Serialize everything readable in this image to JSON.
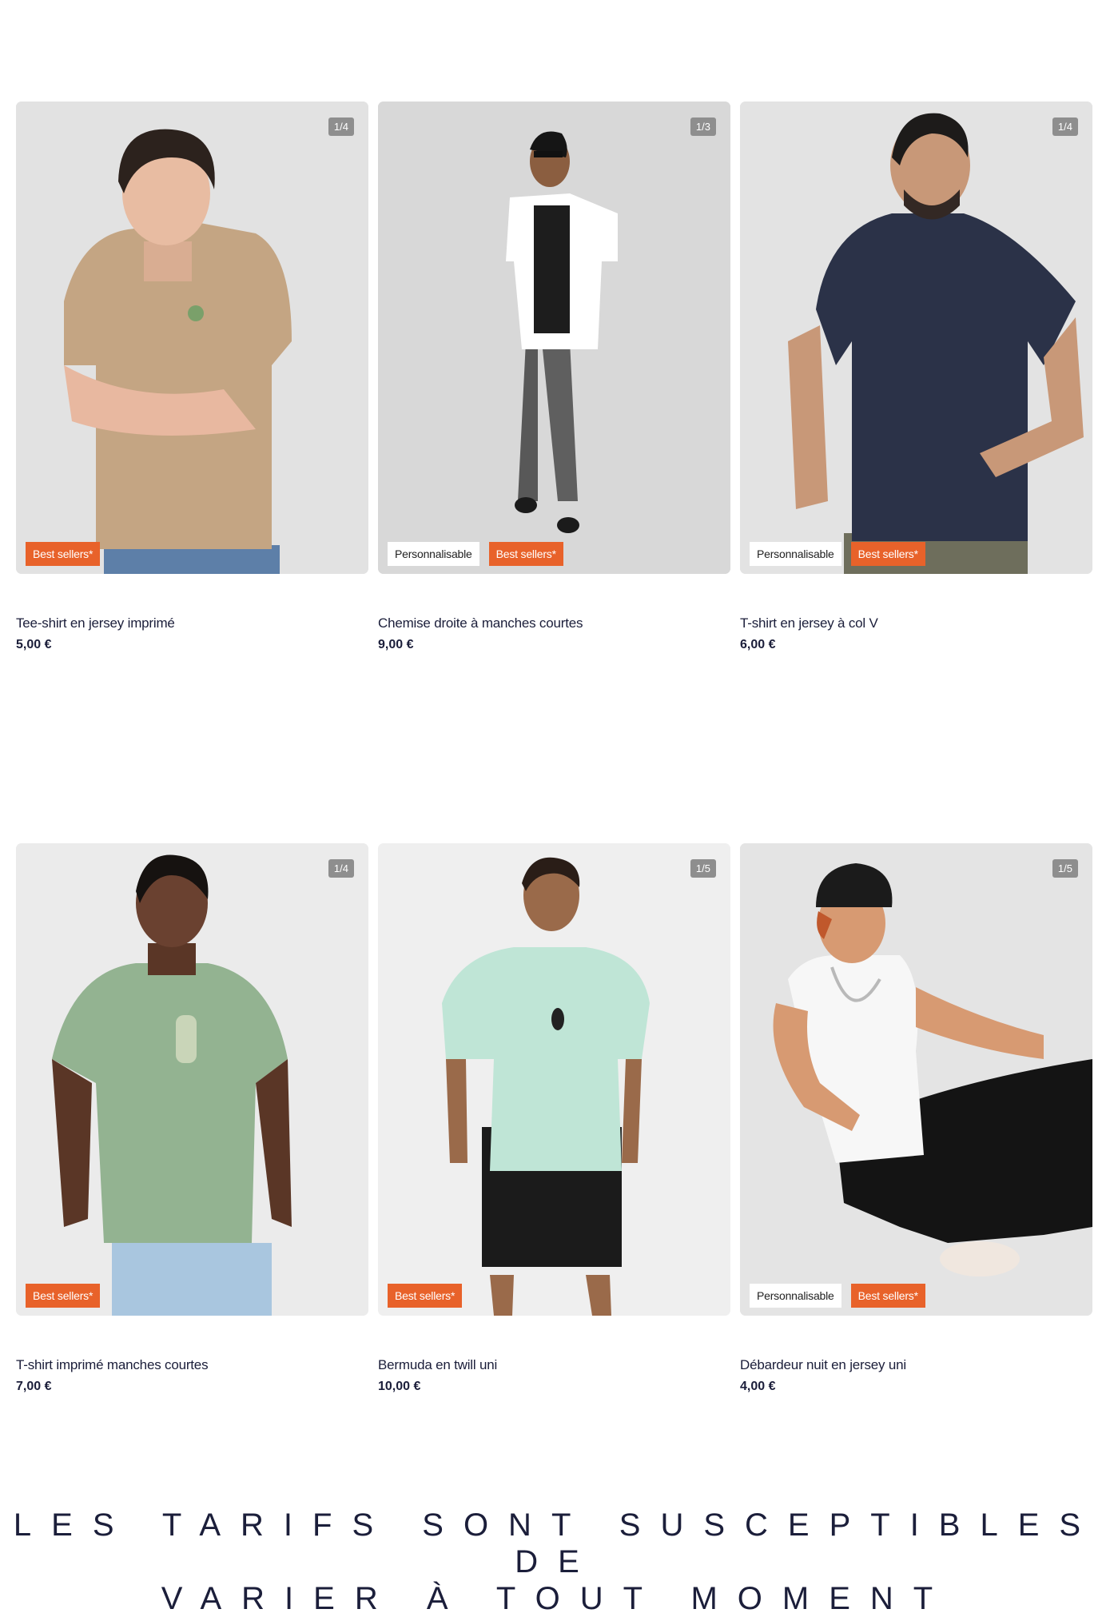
{
  "products": [
    {
      "name": "Tee-shirt en jersey imprimé",
      "price": "5,00 €",
      "counter": "1/4",
      "badges": [
        {
          "label": "Best sellers*",
          "style": "orange"
        }
      ],
      "background": "#e2e2e2",
      "garment_color": "#c4a583"
    },
    {
      "name": "Chemise droite à manches courtes",
      "price": "9,00 €",
      "counter": "1/3",
      "badges": [
        {
          "label": "Personnalisable",
          "style": "white"
        },
        {
          "label": "Best sellers*",
          "style": "orange"
        }
      ],
      "background": "#d8d8d8",
      "garment_color": "#ffffff"
    },
    {
      "name": "T-shirt en jersey à col V",
      "price": "6,00 €",
      "counter": "1/4",
      "badges": [
        {
          "label": "Personnalisable",
          "style": "white"
        },
        {
          "label": "Best sellers*",
          "style": "orange"
        }
      ],
      "background": "#e3e3e3",
      "garment_color": "#2b3248"
    },
    {
      "name": "T-shirt imprimé manches courtes",
      "price": "7,00 €",
      "counter": "1/4",
      "badges": [
        {
          "label": "Best sellers*",
          "style": "orange"
        }
      ],
      "background": "#ebebeb",
      "garment_color": "#93b391"
    },
    {
      "name": "Bermuda en twill uni",
      "price": "10,00 €",
      "counter": "1/5",
      "badges": [
        {
          "label": "Best sellers*",
          "style": "orange"
        }
      ],
      "background": "#efefef",
      "garment_color": "#bfe5d6"
    },
    {
      "name": "Débardeur nuit en jersey uni",
      "price": "4,00 €",
      "counter": "1/5",
      "badges": [
        {
          "label": "Personnalisable",
          "style": "white"
        },
        {
          "label": "Best sellers*",
          "style": "orange"
        }
      ],
      "background": "#e4e4e4",
      "garment_color": "#f7f7f7"
    }
  ],
  "disclaimer": {
    "line1": "LES TARIFS SONT SUSCEPTIBLES DE",
    "line2": "VARIER À TOUT MOMENT"
  },
  "colors": {
    "badge_orange": "#e8622a",
    "counter_gray": "#8e8e8e",
    "text_navy": "#1b1e3a"
  }
}
